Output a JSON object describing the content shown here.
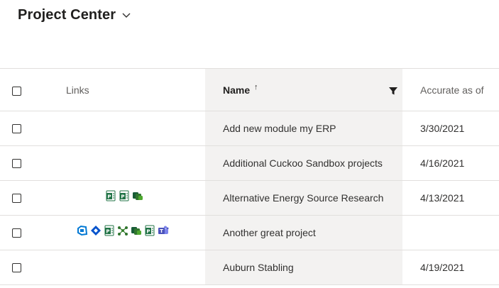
{
  "header": {
    "title": "Project Center"
  },
  "columns": {
    "links": "Links",
    "name": "Name",
    "sort_indicator": "↑",
    "accurate_as_of": "Accurate as of"
  },
  "rows": [
    {
      "name": "Add new module my ERP",
      "accurate_as_of": "3/30/2021",
      "links": []
    },
    {
      "name": "Additional Cuckoo Sandbox projects",
      "accurate_as_of": "4/16/2021",
      "links": []
    },
    {
      "name": "Alternative Energy Source Research",
      "accurate_as_of": "4/13/2021",
      "links": [
        "project-icon",
        "project-icon",
        "planner-icon"
      ]
    },
    {
      "name": "Another great project",
      "accurate_as_of": "",
      "links": [
        "azure-devops-icon",
        "jira-icon",
        "project-icon",
        "flow-icon",
        "planner-icon",
        "project-icon",
        "teams-icon"
      ]
    },
    {
      "name": "Auburn Stabling",
      "accurate_as_of": "4/19/2021",
      "links": []
    }
  ],
  "colors": {
    "name_column_bg": "#f3f2f1",
    "border": "#e1dfdd",
    "project_green": "#217346",
    "planner_green": "#31752f",
    "azure_blue": "#0078d4",
    "jira_blue": "#0052cc",
    "teams_purple": "#6264a7"
  }
}
